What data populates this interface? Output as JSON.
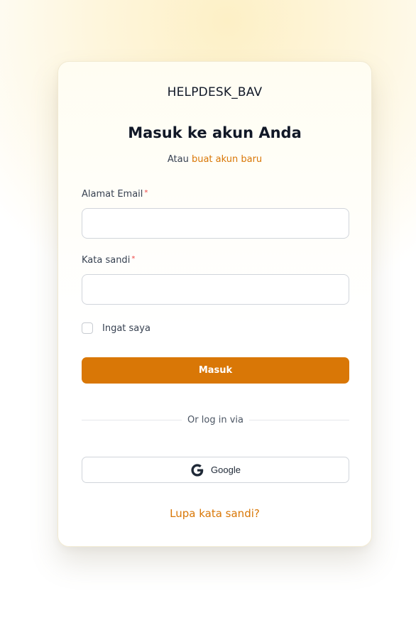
{
  "brand": {
    "name": "HELPDESK_BAV"
  },
  "header": {
    "title": "Masuk ke akun Anda",
    "subtitle_prefix": "Atau",
    "subtitle_link": "buat akun baru"
  },
  "form": {
    "email": {
      "label": "Alamat Email",
      "required_mark": "*",
      "value": "",
      "placeholder": ""
    },
    "password": {
      "label": "Kata sandi",
      "required_mark": "*",
      "value": "",
      "placeholder": ""
    },
    "remember": {
      "label": "Ingat saya",
      "checked": false
    },
    "submit_label": "Masuk"
  },
  "divider": {
    "text": "Or log in via"
  },
  "social": {
    "google": {
      "label": "Google",
      "icon": "google-g-icon"
    }
  },
  "footer": {
    "forgot_link": "Lupa kata sandi?"
  },
  "colors": {
    "accent": "#d97706",
    "required": "#ef4444",
    "text": "#1f2937"
  }
}
